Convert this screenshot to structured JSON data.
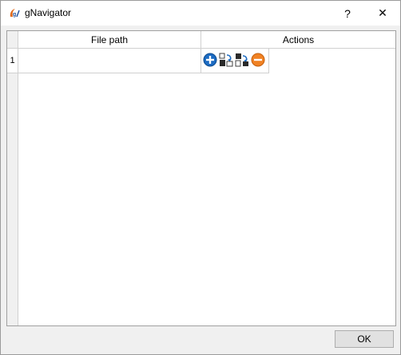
{
  "window": {
    "title": "gNavigator",
    "help_label": "?",
    "close_label": "✕",
    "icon": "app-logo-icon"
  },
  "table": {
    "columns": [
      "File path",
      "Actions"
    ],
    "rows": [
      {
        "row_number": "1",
        "file_path": "",
        "actions": [
          "add-icon",
          "browse-icon",
          "replace-icon",
          "remove-icon"
        ]
      }
    ]
  },
  "footer": {
    "ok_label": "OK"
  },
  "colors": {
    "add": "#1c6bc2",
    "remove": "#f08224",
    "titlebar": "#ffffff",
    "background": "#f0f0f0"
  }
}
